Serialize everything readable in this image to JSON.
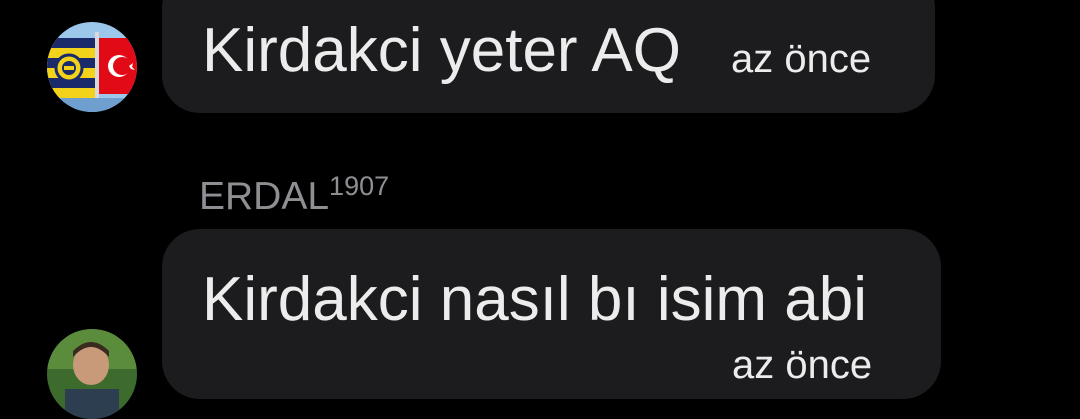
{
  "messages": [
    {
      "sender": "",
      "text": "Kirdakci yeter AQ",
      "time": "az önce",
      "avatar_icon": "fenerbahce-turkish-flag-avatar"
    },
    {
      "sender_name": "ERDAL",
      "sender_suffix": "1907",
      "text": "Kirdakci nasıl bı isim abi",
      "time": "az önce",
      "avatar_icon": "person-photo-avatar"
    }
  ],
  "colors": {
    "background": "#000000",
    "bubble": "#1c1c1e",
    "message_text": "#ececec",
    "sender_text": "#8e8e93"
  }
}
